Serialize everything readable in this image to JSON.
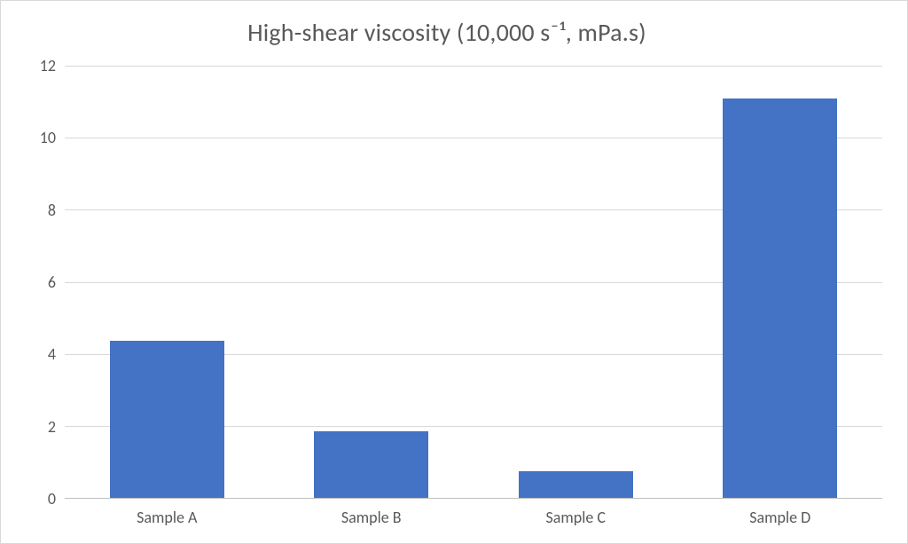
{
  "chart_data": {
    "type": "bar",
    "title": "High-shear viscosity (10,000 s⁻¹, mPa.s)",
    "categories": [
      "Sample A",
      "Sample B",
      "Sample C",
      "Sample D"
    ],
    "values": [
      4.35,
      1.85,
      0.75,
      11.1
    ],
    "ylabel": "",
    "xlabel": "",
    "ylim": [
      0,
      12
    ],
    "y_ticks": [
      0,
      2,
      4,
      6,
      8,
      10,
      12
    ],
    "bar_color": "#4472c4",
    "grid_color": "#d9d9d9"
  }
}
